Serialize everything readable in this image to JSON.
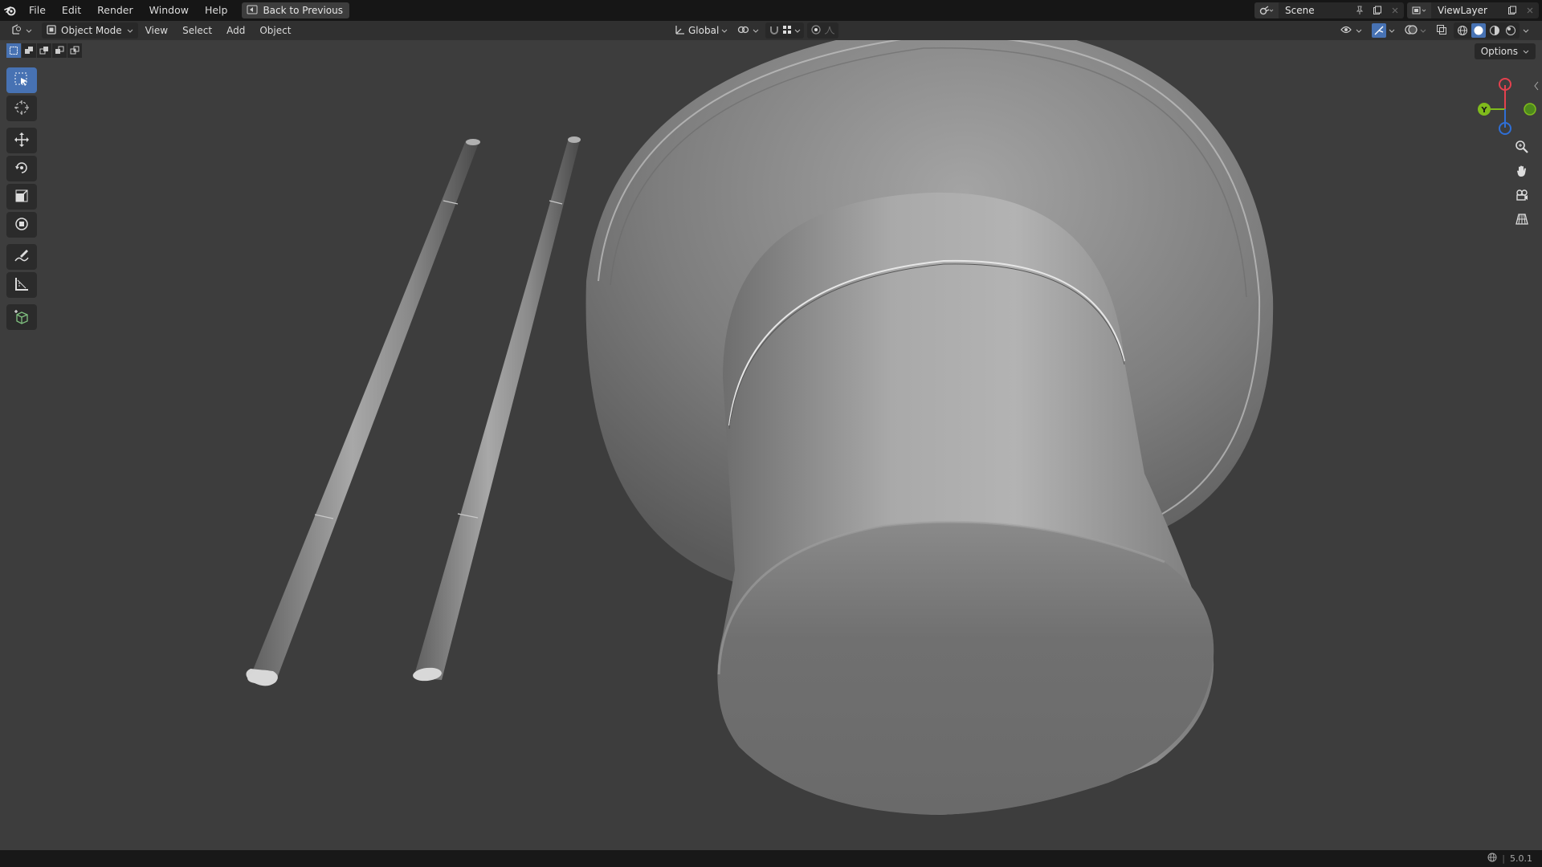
{
  "topbar": {
    "menus": [
      "File",
      "Edit",
      "Render",
      "Window",
      "Help"
    ],
    "back_label": "Back to Previous",
    "scene_name": "Scene",
    "view_layer_name": "ViewLayer"
  },
  "header": {
    "mode": "Object Mode",
    "menus": [
      "View",
      "Select",
      "Add",
      "Object"
    ],
    "orientation": "Global"
  },
  "viewport": {
    "options_label": "Options",
    "gizmo_axes": {
      "y": "Y"
    }
  },
  "statusbar": {
    "version": "5.0.1"
  },
  "colors": {
    "accent": "#4772b3",
    "viewport_bg": "#3d3d3d",
    "axis_x": "#e5414e",
    "axis_y": "#7fbb1c",
    "axis_z": "#2f6fd6"
  }
}
